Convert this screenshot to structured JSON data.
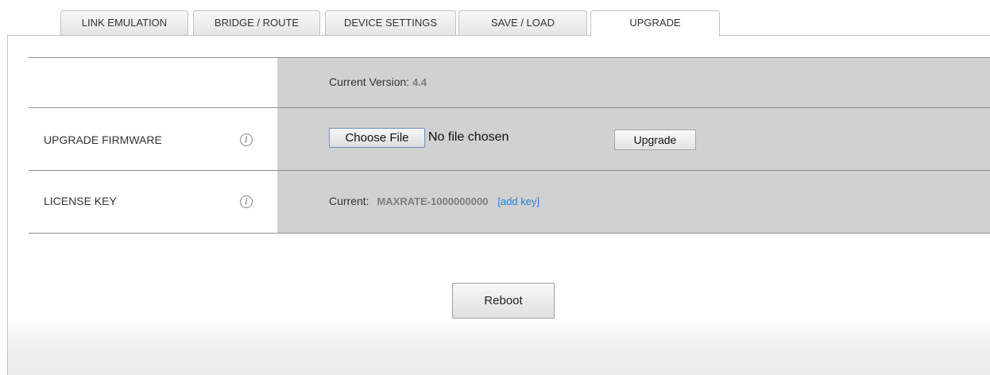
{
  "tabs": [
    {
      "label": "LINK EMULATION",
      "active": false
    },
    {
      "label": "BRIDGE / ROUTE",
      "active": false
    },
    {
      "label": "DEVICE SETTINGS",
      "active": false
    },
    {
      "label": "SAVE / LOAD",
      "active": false
    },
    {
      "label": "UPGRADE",
      "active": true
    }
  ],
  "version_row": {
    "label": "Current Version:",
    "value": "4.4"
  },
  "firmware_row": {
    "label": "UPGRADE FIRMWARE",
    "info_icon": "info-icon",
    "choose_file_label": "Choose File",
    "no_file_text": "No file chosen",
    "upgrade_label": "Upgrade"
  },
  "license_row": {
    "label": "LICENSE KEY",
    "info_icon": "info-icon",
    "current_label": "Current:",
    "current_value": "MAXRATE-1000000000",
    "bracket_open": "[",
    "add_key_label": "add key",
    "bracket_close": "]"
  },
  "reboot_label": "Reboot",
  "colors": {
    "value_gray": "#7d7d7d",
    "link_blue": "#2a7fd4",
    "column_gray": "#d1d1d1"
  }
}
